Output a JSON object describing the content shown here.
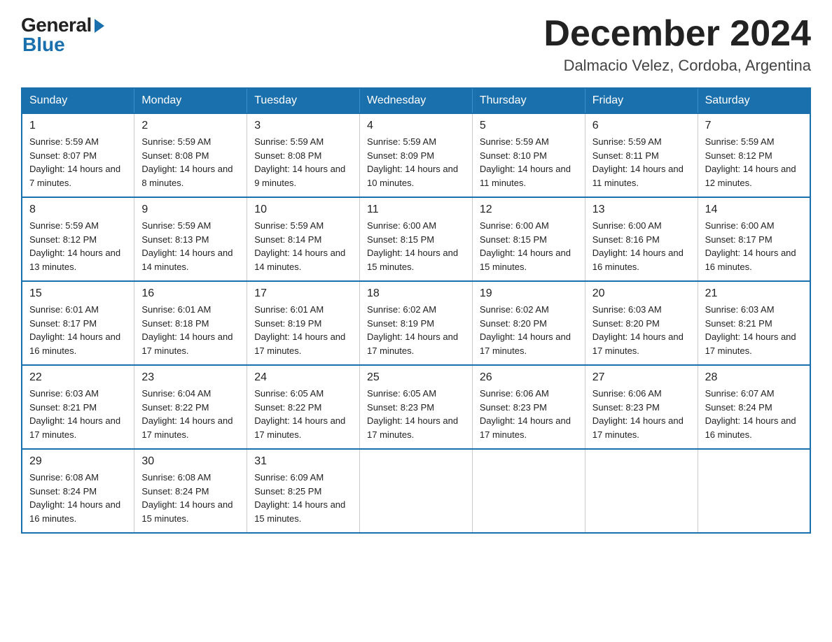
{
  "header": {
    "logo": {
      "general": "General",
      "blue": "Blue"
    },
    "title": "December 2024",
    "location": "Dalmacio Velez, Cordoba, Argentina"
  },
  "weekdays": [
    "Sunday",
    "Monday",
    "Tuesday",
    "Wednesday",
    "Thursday",
    "Friday",
    "Saturday"
  ],
  "weeks": [
    [
      {
        "day": "1",
        "sunrise": "5:59 AM",
        "sunset": "8:07 PM",
        "daylight": "14 hours and 7 minutes."
      },
      {
        "day": "2",
        "sunrise": "5:59 AM",
        "sunset": "8:08 PM",
        "daylight": "14 hours and 8 minutes."
      },
      {
        "day": "3",
        "sunrise": "5:59 AM",
        "sunset": "8:08 PM",
        "daylight": "14 hours and 9 minutes."
      },
      {
        "day": "4",
        "sunrise": "5:59 AM",
        "sunset": "8:09 PM",
        "daylight": "14 hours and 10 minutes."
      },
      {
        "day": "5",
        "sunrise": "5:59 AM",
        "sunset": "8:10 PM",
        "daylight": "14 hours and 11 minutes."
      },
      {
        "day": "6",
        "sunrise": "5:59 AM",
        "sunset": "8:11 PM",
        "daylight": "14 hours and 11 minutes."
      },
      {
        "day": "7",
        "sunrise": "5:59 AM",
        "sunset": "8:12 PM",
        "daylight": "14 hours and 12 minutes."
      }
    ],
    [
      {
        "day": "8",
        "sunrise": "5:59 AM",
        "sunset": "8:12 PM",
        "daylight": "14 hours and 13 minutes."
      },
      {
        "day": "9",
        "sunrise": "5:59 AM",
        "sunset": "8:13 PM",
        "daylight": "14 hours and 14 minutes."
      },
      {
        "day": "10",
        "sunrise": "5:59 AM",
        "sunset": "8:14 PM",
        "daylight": "14 hours and 14 minutes."
      },
      {
        "day": "11",
        "sunrise": "6:00 AM",
        "sunset": "8:15 PM",
        "daylight": "14 hours and 15 minutes."
      },
      {
        "day": "12",
        "sunrise": "6:00 AM",
        "sunset": "8:15 PM",
        "daylight": "14 hours and 15 minutes."
      },
      {
        "day": "13",
        "sunrise": "6:00 AM",
        "sunset": "8:16 PM",
        "daylight": "14 hours and 16 minutes."
      },
      {
        "day": "14",
        "sunrise": "6:00 AM",
        "sunset": "8:17 PM",
        "daylight": "14 hours and 16 minutes."
      }
    ],
    [
      {
        "day": "15",
        "sunrise": "6:01 AM",
        "sunset": "8:17 PM",
        "daylight": "14 hours and 16 minutes."
      },
      {
        "day": "16",
        "sunrise": "6:01 AM",
        "sunset": "8:18 PM",
        "daylight": "14 hours and 17 minutes."
      },
      {
        "day": "17",
        "sunrise": "6:01 AM",
        "sunset": "8:19 PM",
        "daylight": "14 hours and 17 minutes."
      },
      {
        "day": "18",
        "sunrise": "6:02 AM",
        "sunset": "8:19 PM",
        "daylight": "14 hours and 17 minutes."
      },
      {
        "day": "19",
        "sunrise": "6:02 AM",
        "sunset": "8:20 PM",
        "daylight": "14 hours and 17 minutes."
      },
      {
        "day": "20",
        "sunrise": "6:03 AM",
        "sunset": "8:20 PM",
        "daylight": "14 hours and 17 minutes."
      },
      {
        "day": "21",
        "sunrise": "6:03 AM",
        "sunset": "8:21 PM",
        "daylight": "14 hours and 17 minutes."
      }
    ],
    [
      {
        "day": "22",
        "sunrise": "6:03 AM",
        "sunset": "8:21 PM",
        "daylight": "14 hours and 17 minutes."
      },
      {
        "day": "23",
        "sunrise": "6:04 AM",
        "sunset": "8:22 PM",
        "daylight": "14 hours and 17 minutes."
      },
      {
        "day": "24",
        "sunrise": "6:05 AM",
        "sunset": "8:22 PM",
        "daylight": "14 hours and 17 minutes."
      },
      {
        "day": "25",
        "sunrise": "6:05 AM",
        "sunset": "8:23 PM",
        "daylight": "14 hours and 17 minutes."
      },
      {
        "day": "26",
        "sunrise": "6:06 AM",
        "sunset": "8:23 PM",
        "daylight": "14 hours and 17 minutes."
      },
      {
        "day": "27",
        "sunrise": "6:06 AM",
        "sunset": "8:23 PM",
        "daylight": "14 hours and 17 minutes."
      },
      {
        "day": "28",
        "sunrise": "6:07 AM",
        "sunset": "8:24 PM",
        "daylight": "14 hours and 16 minutes."
      }
    ],
    [
      {
        "day": "29",
        "sunrise": "6:08 AM",
        "sunset": "8:24 PM",
        "daylight": "14 hours and 16 minutes."
      },
      {
        "day": "30",
        "sunrise": "6:08 AM",
        "sunset": "8:24 PM",
        "daylight": "14 hours and 15 minutes."
      },
      {
        "day": "31",
        "sunrise": "6:09 AM",
        "sunset": "8:25 PM",
        "daylight": "14 hours and 15 minutes."
      },
      null,
      null,
      null,
      null
    ]
  ]
}
